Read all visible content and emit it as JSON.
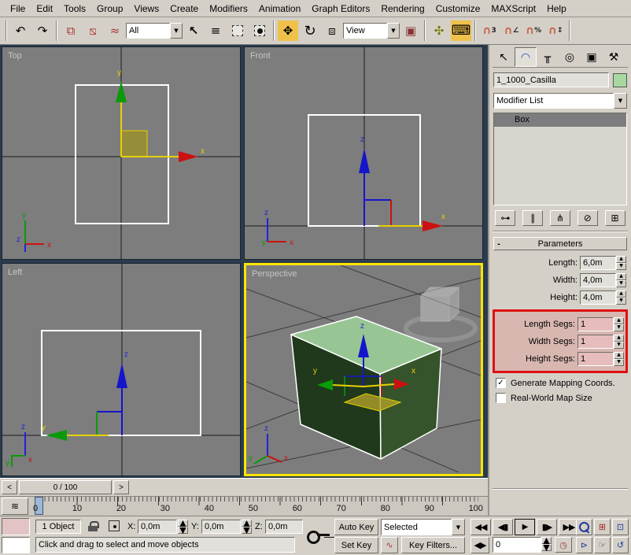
{
  "colors": {
    "active_viewport_border": "#ffe400",
    "segment_highlight_red": "#dd1111",
    "object_color": "#a8d8a0",
    "active_tool_yellow": "#f0c14a"
  },
  "menu": {
    "items": [
      "File",
      "Edit",
      "Tools",
      "Group",
      "Views",
      "Create",
      "Modifiers",
      "Animation",
      "Graph Editors",
      "Rendering",
      "Customize",
      "MAXScript",
      "Help"
    ]
  },
  "toolbar": {
    "selection_filter": "All",
    "coordinate_system": "View"
  },
  "viewports": {
    "top": "Top",
    "front": "Front",
    "left": "Left",
    "perspective": "Perspective",
    "axis_x": "x",
    "axis_y": "y",
    "axis_z": "z"
  },
  "timeline": {
    "slider": "0 / 100",
    "ticks": [
      "0",
      "10",
      "20",
      "30",
      "40",
      "50",
      "60",
      "70",
      "80",
      "90",
      "100"
    ]
  },
  "command_panel": {
    "object_name": "1_1000_Casilla",
    "modifier_list": "Modifier List",
    "stack": [
      {
        "label": "Box"
      }
    ],
    "parameters": {
      "title": "Parameters",
      "fields": [
        {
          "label": "Length:",
          "value": "6,0m"
        },
        {
          "label": "Width:",
          "value": "4,0m"
        },
        {
          "label": "Height:",
          "value": "4,0m"
        }
      ],
      "seg_fields": [
        {
          "label": "Length Segs:",
          "value": "1"
        },
        {
          "label": "Width Segs:",
          "value": "1"
        },
        {
          "label": "Height Segs:",
          "value": "1"
        }
      ],
      "checkbox_mapping": "Generate Mapping Coords.",
      "checkbox_realworld": "Real-World Map Size"
    }
  },
  "status": {
    "selection_count": "1 Object",
    "x_label": "X:",
    "x_value": "0,0m",
    "y_label": "Y:",
    "y_value": "0,0m",
    "z_label": "Z:",
    "z_value": "0,0m",
    "prompt": "Click and drag to select and move objects"
  },
  "animation": {
    "auto_key": "Auto Key",
    "set_key": "Set Key",
    "key_mode": "Selected",
    "key_filters": "Key Filters...",
    "frame": "0"
  },
  "icons": {
    "undo": "↶",
    "redo": "↷",
    "select_link": "⧉",
    "unlink": "⧅",
    "bind_spacewarp": "≈",
    "select": "↖",
    "select_by_name": "≡",
    "move": "✥",
    "rotate": "↻",
    "scale": "⧈",
    "pivot_center": "▣",
    "manipulate": "✣",
    "keyboard_override": "⌨",
    "magnet": "∩",
    "snap3_sup": "3",
    "angle_sup": "∠",
    "percent_sup": "%",
    "spinner_sup": "↕",
    "dropdown_arrow": "▼",
    "spin_up": "▲",
    "spin_down": "▼",
    "tab_create": "↖",
    "tab_modify": "◠",
    "tab_hierarchy": "╥",
    "tab_motion": "◎",
    "tab_display": "▣",
    "tab_utilities": "⚒",
    "pin_stack": "⊶",
    "show_end_result": "∥",
    "make_unique": "⋔",
    "remove_modifier": "⊘",
    "configure_sets": "⊞",
    "check": "✓",
    "collapse": "-",
    "mini_curve": "≋",
    "prev_arrow": "<",
    "next_arrow": ">",
    "go_start": "◀◀",
    "prev_frame": "◀▮",
    "play": "▶",
    "next_frame": "▮▶",
    "go_end": "▶▶",
    "key_step": "◀▶",
    "time_config": "◷",
    "curve": "∿",
    "zoom_all": "⊞",
    "zoom_extents": "⊡",
    "zoom_extents_all": "⧈",
    "fov": "⊳",
    "pan": "☞",
    "arc_rotate": "↺",
    "minmax": "◲"
  }
}
